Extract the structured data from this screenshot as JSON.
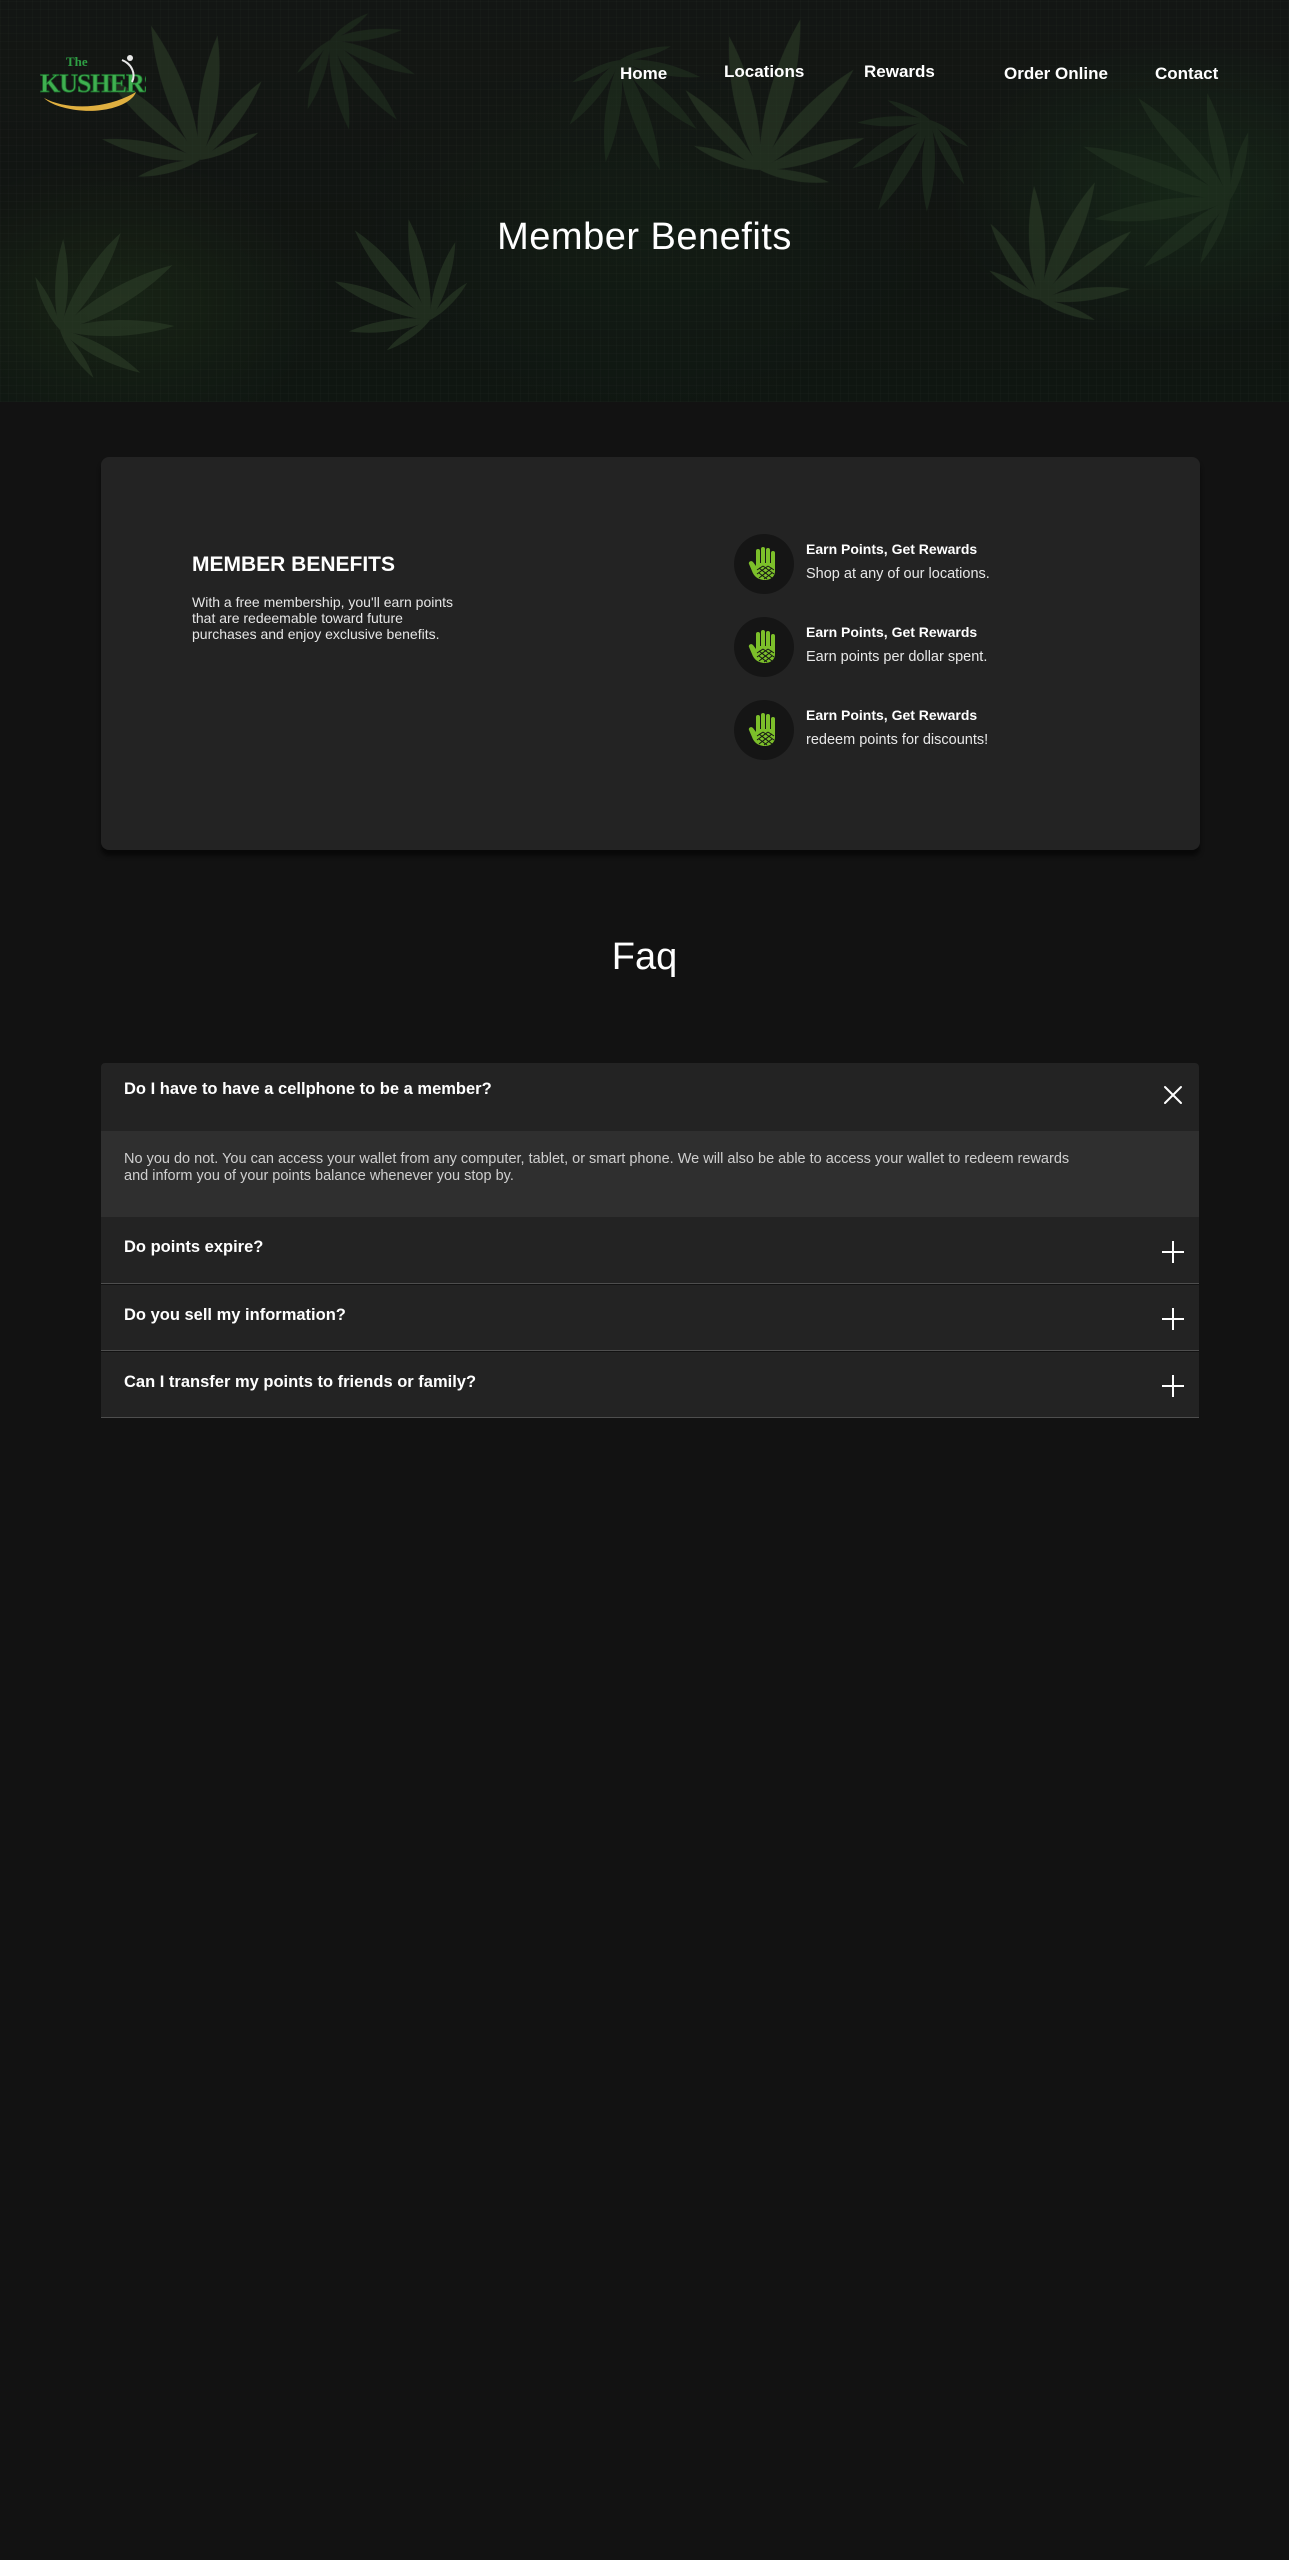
{
  "brand": {
    "logo_text_top": "The",
    "logo_text_main": "KUSHERS"
  },
  "nav": {
    "items": [
      {
        "label": "Home"
      },
      {
        "label": "Locations"
      },
      {
        "label": "Rewards"
      },
      {
        "label": "Order Online"
      },
      {
        "label": "Contact"
      }
    ]
  },
  "hero": {
    "title": "Member Benefits"
  },
  "benefits": {
    "heading": "MEMBER BENEFITS",
    "description": "With a free membership, you'll earn points that are redeemable toward future purchases and enjoy exclusive benefits.",
    "items": [
      {
        "title": "Earn Points, Get Rewards",
        "text": "Shop at any of our locations.",
        "icon": "hand-icon"
      },
      {
        "title": "Earn Points, Get Rewards",
        "text": "Earn points per dollar spent.",
        "icon": "hand-icon"
      },
      {
        "title": "Earn Points, Get Rewards",
        "text": "redeem points for discounts!",
        "icon": "hand-icon"
      }
    ]
  },
  "faq": {
    "title": "Faq",
    "items": [
      {
        "question": "Do I have to have a cellphone to be a member?",
        "expanded": true,
        "answer": "No you do not. You can access your wallet from any computer, tablet, or smart phone. We will also be able to access your wallet to redeem rewards and inform you of your points balance whenever you stop by."
      },
      {
        "question": "Do points expire?",
        "expanded": false
      },
      {
        "question": "Do you sell my information?",
        "expanded": false
      },
      {
        "question": "Can I transfer my points to friends or family?",
        "expanded": false
      }
    ]
  },
  "colors": {
    "background": "#121212",
    "card": "#232323",
    "answer_panel": "#2f2f2f",
    "icon_green": "#7cbf2a",
    "logo_green": "#2e9e44",
    "logo_gold": "#e0b040"
  }
}
